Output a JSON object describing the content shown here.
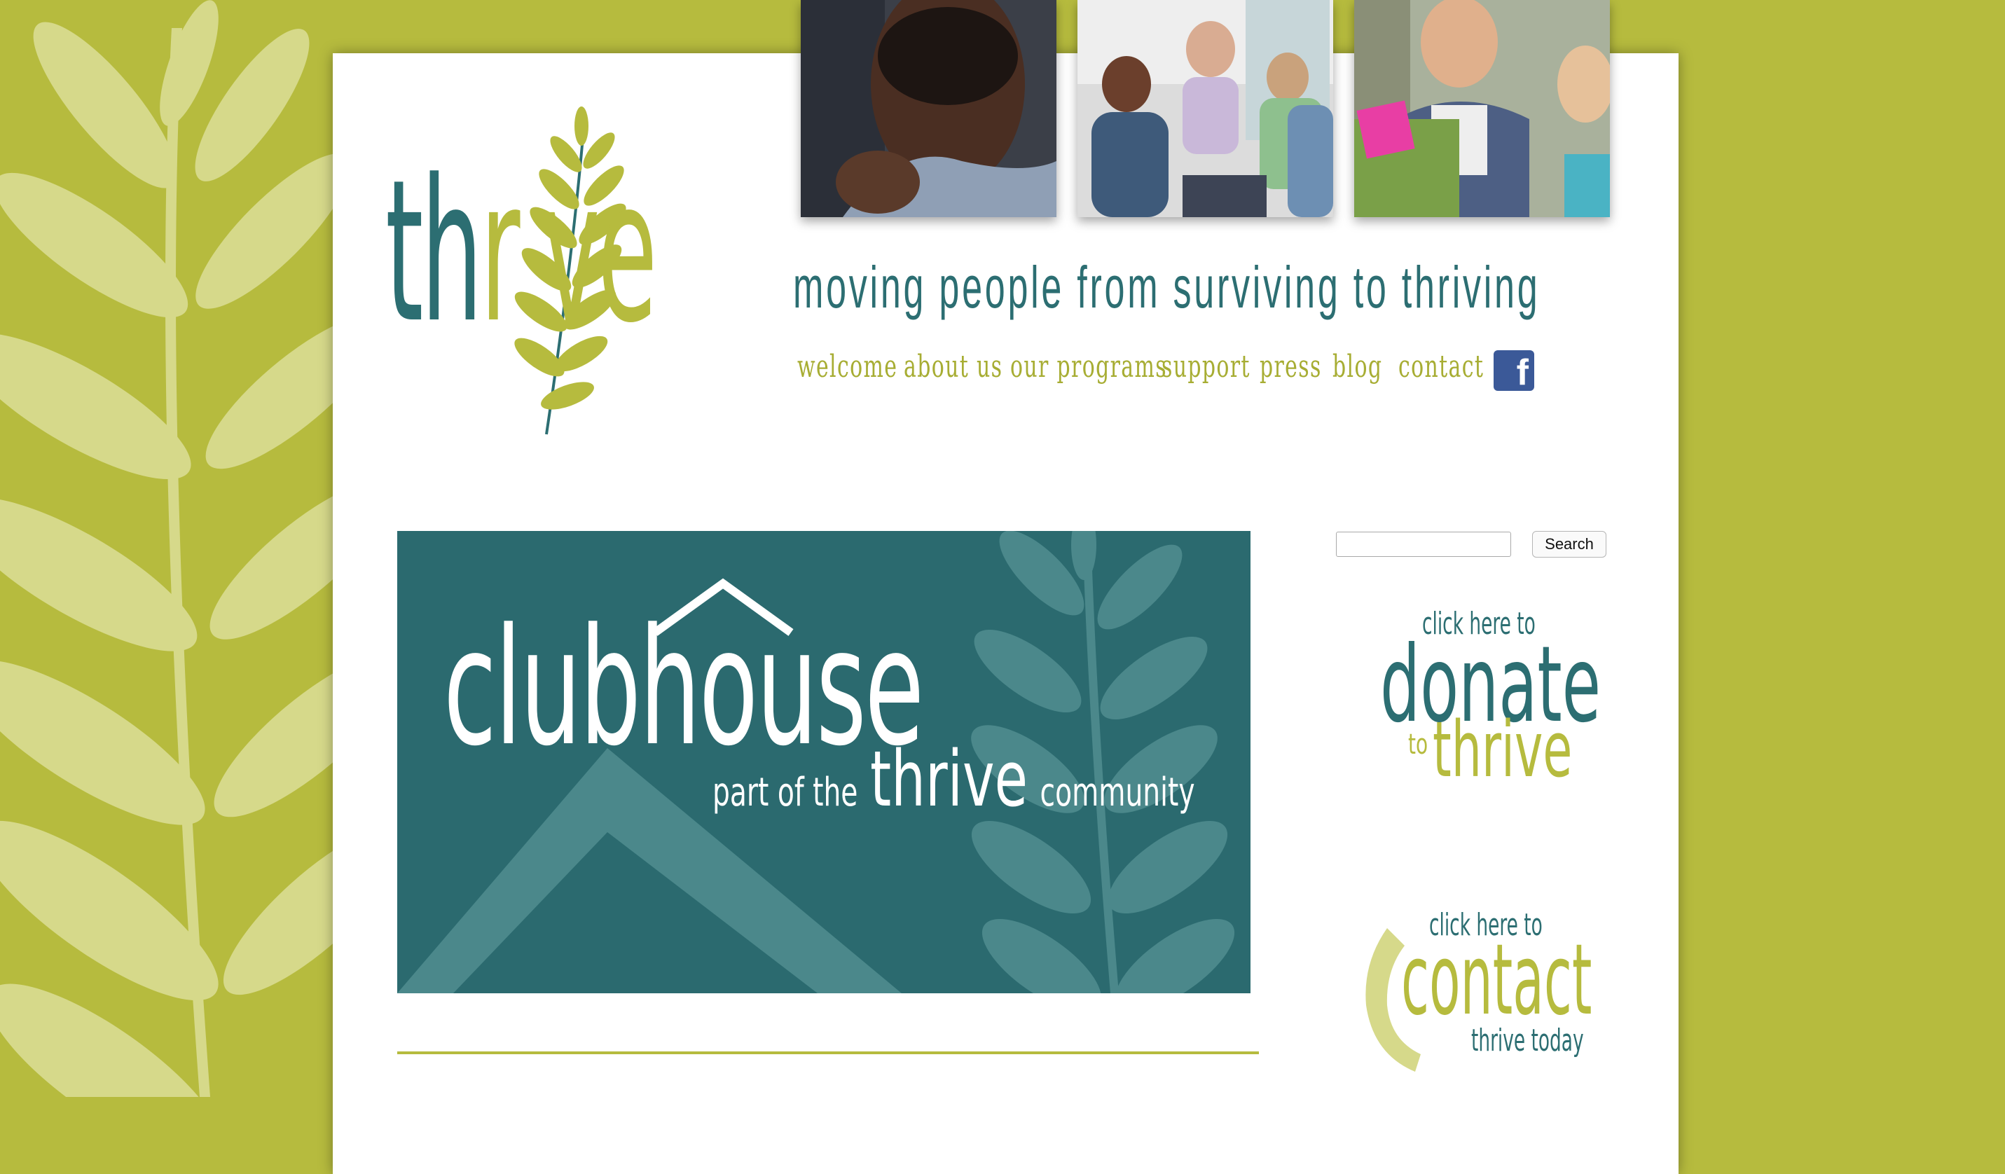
{
  "brand": {
    "name": "thrive",
    "logo_parts": [
      "th",
      "r",
      "i",
      "ve"
    ]
  },
  "tagline": "moving people from surviving to thriving",
  "nav": {
    "items": [
      {
        "label": "welcome"
      },
      {
        "label": "about us"
      },
      {
        "label": "our programs"
      },
      {
        "label": "support"
      },
      {
        "label": "press"
      },
      {
        "label": "blog"
      },
      {
        "label": "contact"
      }
    ],
    "facebook_icon": "facebook-icon"
  },
  "banner": {
    "title": "clubhouse",
    "subtitle_prefix": "part of the",
    "subtitle_brand": "thrive",
    "subtitle_suffix": "community"
  },
  "search": {
    "value": "",
    "button_label": "Search"
  },
  "donate": {
    "line1": "click here to",
    "line2": "donate",
    "line3": "to",
    "line4": "thrive"
  },
  "contact": {
    "line1": "click here to",
    "line2": "contact",
    "line3": "thrive today",
    "icon": "phone-icon"
  },
  "colors": {
    "olive": "#b6bb3e",
    "teal": "#2c6e72",
    "light_olive": "#d6d98a",
    "white": "#ffffff"
  }
}
